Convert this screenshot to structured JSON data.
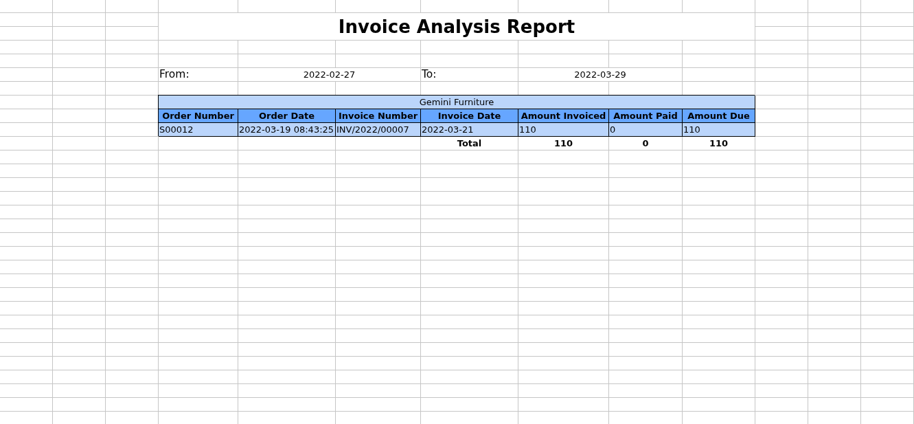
{
  "title": "Invoice Analysis Report",
  "period": {
    "from_label": "From:",
    "from_value": "2022-02-27",
    "to_label": "To:",
    "to_value": "2022-03-29"
  },
  "table": {
    "group": "Gemini Furniture",
    "columns": [
      "Order Number",
      "Order Date",
      "Invoice Number",
      "Invoice Date",
      "Amount Invoiced",
      "Amount Paid",
      "Amount Due"
    ],
    "rows": [
      [
        "S00012",
        "2022-03-19 08:43:25",
        "INV/2022/00007",
        "2022-03-21",
        "110",
        "0",
        "110"
      ]
    ],
    "totals": {
      "label": "Total",
      "values": [
        "110",
        "0",
        "110"
      ]
    }
  }
}
